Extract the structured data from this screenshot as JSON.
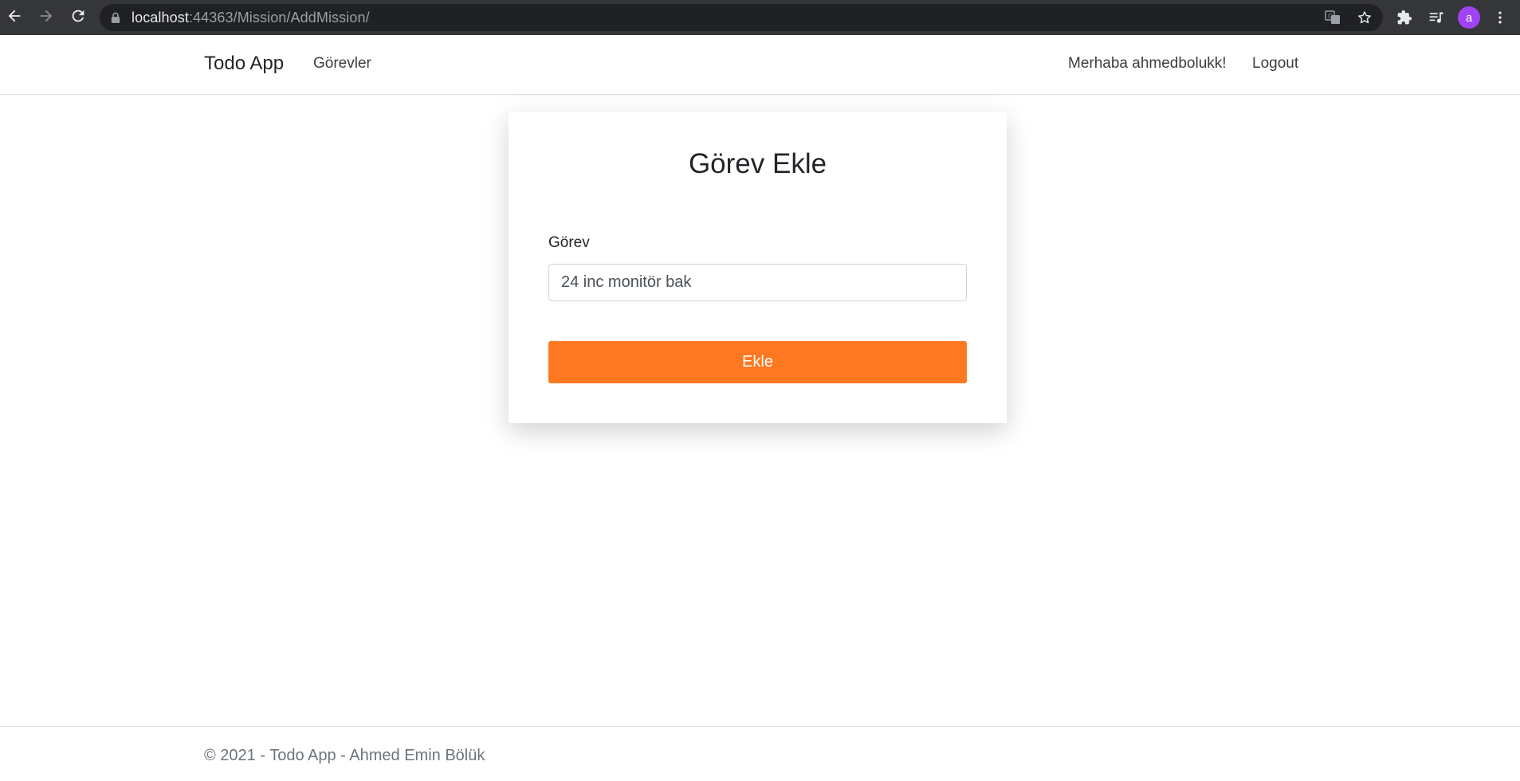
{
  "browser": {
    "url_host": "localhost",
    "url_rest": ":44363/Mission/AddMission/",
    "profile_initial": "a",
    "icons": [
      "back-arrow-icon",
      "forward-arrow-icon",
      "reload-icon",
      "lock-icon",
      "translate-icon",
      "star-icon",
      "puzzle-icon",
      "reading-list-icon",
      "kebab-menu-icon"
    ]
  },
  "navbar": {
    "brand": "Todo App",
    "links": {
      "tasks": "Görevler"
    },
    "greeting": "Merhaba ahmedbolukk!",
    "logout": "Logout"
  },
  "form": {
    "title": "Görev Ekle",
    "field_label": "Görev",
    "field_value": "24 inc monitör bak",
    "submit_label": "Ekle"
  },
  "footer": {
    "text": "© 2021 - Todo App - Ahmed Emin Bölük"
  },
  "colors": {
    "accent": "#fd7820",
    "chrome_bg": "#35363a",
    "omnibox_bg": "#202124",
    "profile": "#a142f4"
  }
}
